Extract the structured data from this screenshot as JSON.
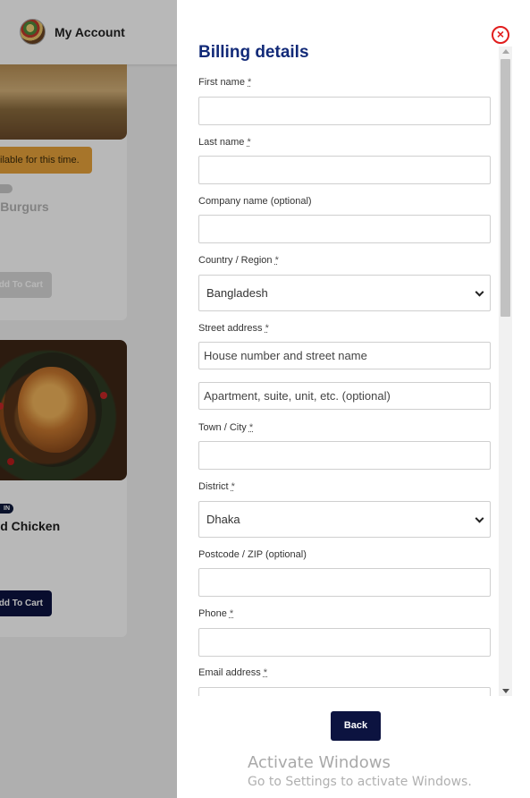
{
  "header": {
    "account_label": "My Account"
  },
  "background_products": [
    {
      "notice": "ilable for this time.",
      "title": "us Burgurs",
      "button": "dd To Cart"
    },
    {
      "tag": "IN",
      "title": "sted Chicken",
      "button": "dd To Cart"
    }
  ],
  "drawer": {
    "close_icon": "×",
    "title": "Billing details",
    "fields": {
      "first_name": {
        "label": "First name",
        "required": "*",
        "value": ""
      },
      "last_name": {
        "label": "Last name",
        "required": "*",
        "value": ""
      },
      "company": {
        "label": "Company name (optional)",
        "value": ""
      },
      "country": {
        "label": "Country / Region",
        "required": "*",
        "value": "Bangladesh"
      },
      "street": {
        "label": "Street address",
        "required": "*",
        "placeholder1": "House number and street name",
        "placeholder2": "Apartment, suite, unit, etc. (optional)"
      },
      "town": {
        "label": "Town / City",
        "required": "*",
        "value": ""
      },
      "district": {
        "label": "District",
        "required": "*",
        "value": "Dhaka"
      },
      "postcode": {
        "label": "Postcode / ZIP (optional)",
        "value": ""
      },
      "phone": {
        "label": "Phone",
        "required": "*",
        "value": ""
      },
      "email": {
        "label": "Email address",
        "required": "*",
        "value": ""
      }
    },
    "back_label": "Back"
  },
  "watermark": {
    "title": "Activate Windows",
    "subtitle": "Go to Settings to activate Windows."
  },
  "colors": {
    "navy": "#0c1340",
    "title_blue": "#122a78",
    "close_red": "#e11d1d",
    "notice_orange": "#e8a23b"
  }
}
